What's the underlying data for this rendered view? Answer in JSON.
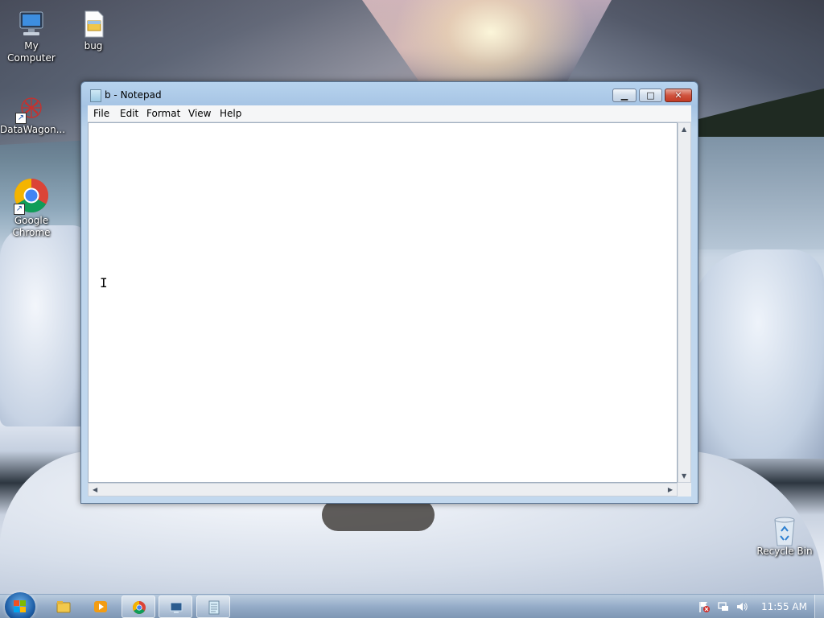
{
  "desktop": {
    "icons": [
      {
        "label": "My Computer"
      },
      {
        "label": "bug"
      },
      {
        "label": "DataWagon..."
      },
      {
        "label": "Google Chrome"
      },
      {
        "label": "Recycle Bin"
      }
    ]
  },
  "notepad": {
    "title": "b - Notepad",
    "window_buttons": {
      "minimize": "▁",
      "maximize": "□",
      "close": "✕"
    },
    "menu": [
      "File",
      "Edit",
      "Format",
      "View",
      "Help"
    ],
    "content": ""
  },
  "taskbar": {
    "items": [
      "windows-explorer-icon",
      "media-player-icon",
      "chrome-icon",
      "remote-desktop-icon",
      "notepad-icon"
    ],
    "clock": "11:55 AM"
  }
}
